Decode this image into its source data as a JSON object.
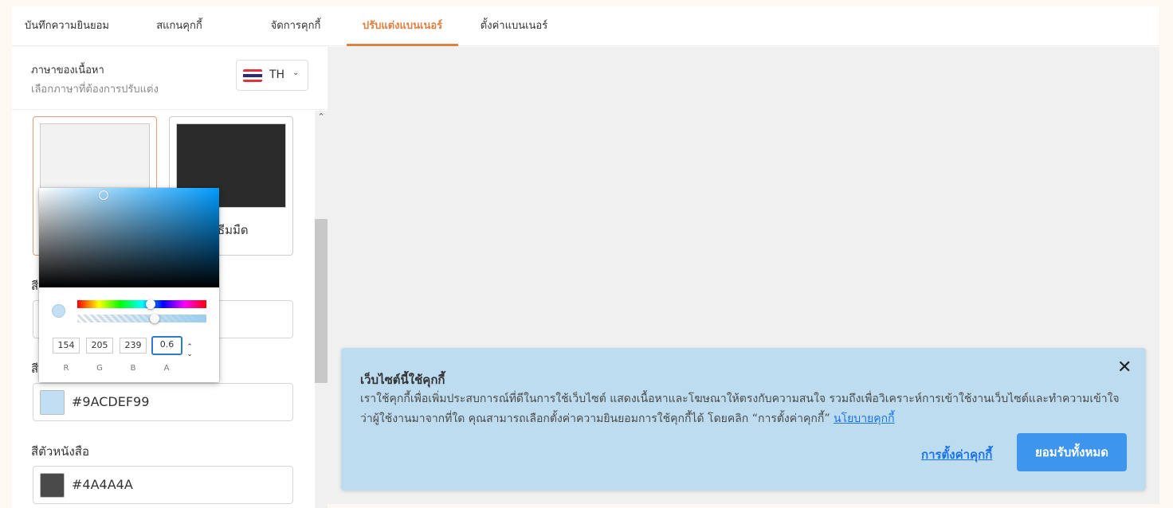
{
  "tabs": [
    {
      "label": "บันทึกความยินยอม",
      "active": false
    },
    {
      "label": "สแกนคุกกี้",
      "active": false
    },
    {
      "label": "จัดการคุกกี้",
      "active": false
    },
    {
      "label": "ปรับแต่งแบนเนอร์",
      "active": true
    },
    {
      "label": "ตั้งค่าแบนเนอร์",
      "active": false
    }
  ],
  "language": {
    "title": "ภาษาของเนื้อหา",
    "subtitle": "เลือกภาษาที่ต้องการปรับแต่ง",
    "code": "TH",
    "flag_icon": "thailand-flag-icon"
  },
  "themes": [
    {
      "label": "",
      "swatch": "#f2f2f2",
      "selected": true
    },
    {
      "label": "ธีมมืด",
      "swatch": "#2b2b2b",
      "selected": false
    }
  ],
  "fields": [
    {
      "label": "สีพื้นหลัง",
      "value": "",
      "chip": "#f2f2f2"
    },
    {
      "label": "สีพื้นหลังแบนเนอร์",
      "value": "#9ACDEF99",
      "chip": "#c2def2"
    },
    {
      "label": "สีตัวหนังสือ",
      "value": "#4A4A4A",
      "chip": "#4a4a4a"
    }
  ],
  "color_picker": {
    "r": "154",
    "g": "205",
    "b": "239",
    "a": "0.6",
    "labels": {
      "r": "R",
      "g": "G",
      "b": "B",
      "a": "A"
    },
    "hue_level": 0.56,
    "alpha_level": 0.6
  },
  "banner": {
    "title": "เว็บไซต์นี้ใช้คุกกี้",
    "text": "เราใช้คุกกี้เพื่อเพิ่มประสบการณ์ที่ดีในการใช้เว็บไซต์ แสดงเนื้อหาและโฆษณาให้ตรงกับความสนใจ รวมถึงเพื่อวิเคราะห์การเข้าใช้งานเว็บไซต์และทำความเข้าใจว่าผู้ใช้งานมาจากที่ใด คุณสามารถเลือกตั้งค่าความยินยอมการใช้คุกกี้ได้ โดยคลิก “การตั้งค่าคุกกี้” ",
    "policy_link": "นโยบายคุกกี้",
    "settings_link": "การตั้งค่าคุกกี้",
    "accept_button": "ยอมรับทั้งหมด",
    "close_symbol": "✕",
    "background": "#bedcf0"
  },
  "accent_color": "#e08043"
}
